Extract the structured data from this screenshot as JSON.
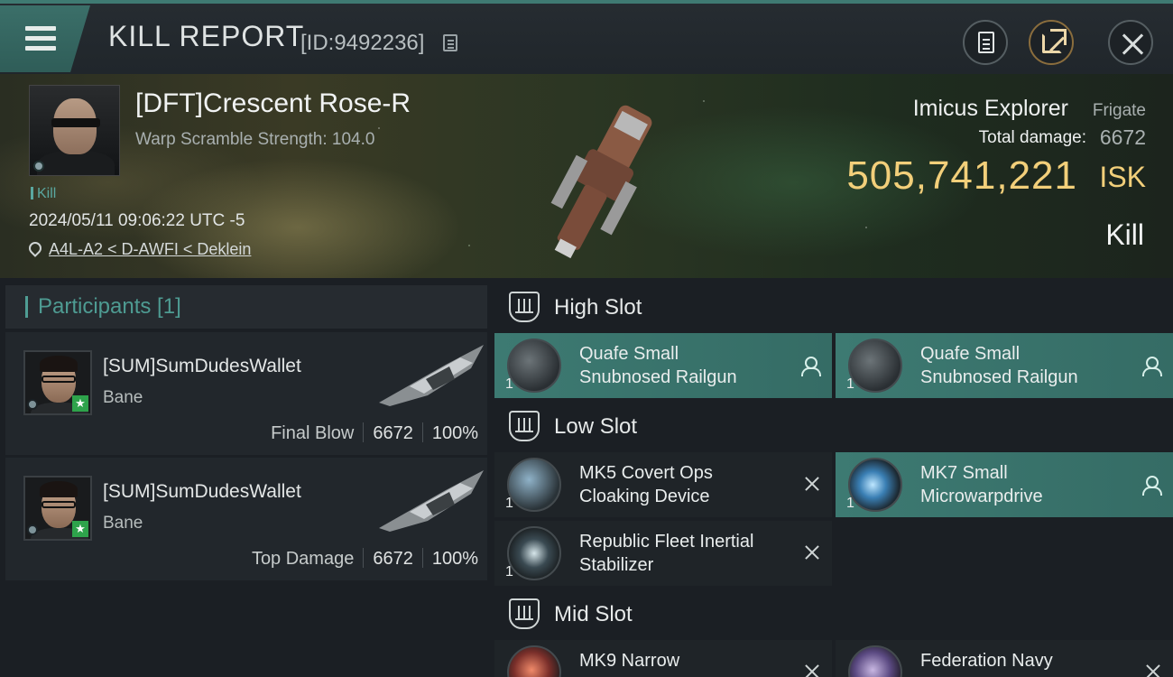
{
  "header": {
    "title": "KILL REPORT",
    "report_id": "[ID:9492236]"
  },
  "victim": {
    "name": "[DFT]Crescent Rose-R",
    "stat": "Warp Scramble Strength: 104.0",
    "tag": "Kill",
    "datetime": "2024/05/11 09:06:22 UTC -5",
    "location": "A4L-A2 < D-AWFI < Deklein",
    "ship_name": "Imicus Explorer",
    "ship_class": "Frigate",
    "total_damage_label": "Total damage:",
    "total_damage": "6672",
    "isk_value": "505,741,221",
    "isk_unit": "ISK",
    "kill_type": "Kill"
  },
  "participants": {
    "title": "Participants [1]",
    "items": [
      {
        "name": "[SUM]SumDudesWallet",
        "ship": "Bane",
        "role": "Final Blow",
        "damage": "6672",
        "percent": "100%"
      },
      {
        "name": "[SUM]SumDudesWallet",
        "ship": "Bane",
        "role": "Top Damage",
        "damage": "6672",
        "percent": "100%"
      }
    ]
  },
  "fitting": {
    "high": {
      "title": "High Slot",
      "modules": [
        {
          "line1": "Quafe Small",
          "line2": "Snubnosed Railgun",
          "qty": "1"
        },
        {
          "line1": "Quafe Small",
          "line2": "Snubnosed Railgun",
          "qty": "1"
        }
      ]
    },
    "low": {
      "title": "Low Slot",
      "modules": [
        {
          "line1": "MK5 Covert Ops",
          "line2": "Cloaking Device",
          "qty": "1"
        },
        {
          "line1": "MK7 Small",
          "line2": "Microwarpdrive",
          "qty": "1"
        },
        {
          "line1": "Republic Fleet Inertial",
          "line2": "Stabilizer",
          "qty": "1"
        }
      ]
    },
    "mid": {
      "title": "Mid Slot",
      "modules": [
        {
          "line1": "MK9 Narrow",
          "line2": "",
          "qty": ""
        },
        {
          "line1": "Federation Navy",
          "line2": "",
          "qty": ""
        }
      ]
    }
  },
  "colors": {
    "accent_teal": "#3d7a72",
    "isk_gold": "#f2cf7a",
    "participants_teal": "#4e9b92"
  },
  "icons": [
    "menu-icon",
    "copy-icon",
    "clipboard-icon",
    "share-icon",
    "close-icon",
    "location-pin-icon",
    "slot-icon",
    "pilot-icon",
    "destroyed-icon",
    "star-badge-icon"
  ]
}
